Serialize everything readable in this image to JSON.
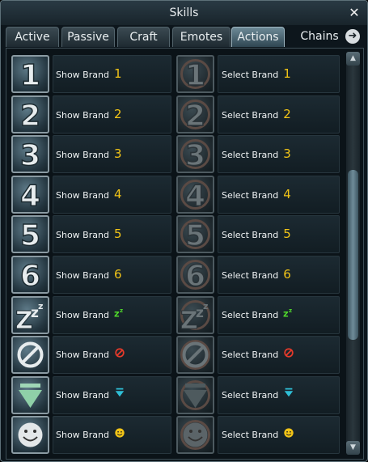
{
  "window": {
    "title": "Skills",
    "close_glyph": "✕"
  },
  "tabs": [
    {
      "label": "Active"
    },
    {
      "label": "Passive"
    },
    {
      "label": "Craft"
    },
    {
      "label": "Emotes"
    },
    {
      "label": "Actions",
      "active": true
    },
    {
      "label": "Chains"
    }
  ],
  "tab_next_glyph": "➜",
  "rows": [
    {
      "show": "Show Brand",
      "select": "Select Brand",
      "value": "1",
      "kind": "num"
    },
    {
      "show": "Show Brand",
      "select": "Select Brand",
      "value": "2",
      "kind": "num"
    },
    {
      "show": "Show Brand",
      "select": "Select Brand",
      "value": "3",
      "kind": "num"
    },
    {
      "show": "Show Brand",
      "select": "Select Brand",
      "value": "4",
      "kind": "num"
    },
    {
      "show": "Show Brand",
      "select": "Select Brand",
      "value": "5",
      "kind": "num"
    },
    {
      "show": "Show Brand",
      "select": "Select Brand",
      "value": "6",
      "kind": "num"
    },
    {
      "show": "Show Brand",
      "select": "Select Brand",
      "value": "zzz",
      "kind": "sleep-icon"
    },
    {
      "show": "Show Brand",
      "select": "Select Brand",
      "value": "",
      "kind": "no-symbol-icon"
    },
    {
      "show": "Show Brand",
      "select": "Select Brand",
      "value": "",
      "kind": "down-arrow-icon"
    },
    {
      "show": "Show Brand",
      "select": "Select Brand",
      "value": "",
      "kind": "smiley-icon"
    }
  ],
  "scroll_glyphs": {
    "up": "▲",
    "down": "▼"
  },
  "colors": {
    "number": "#f2c417",
    "sleep": "#4fd62b",
    "no_symbol": "#e53a2a",
    "arrow": "#2fbfd6",
    "smiley": "#f2c417"
  }
}
